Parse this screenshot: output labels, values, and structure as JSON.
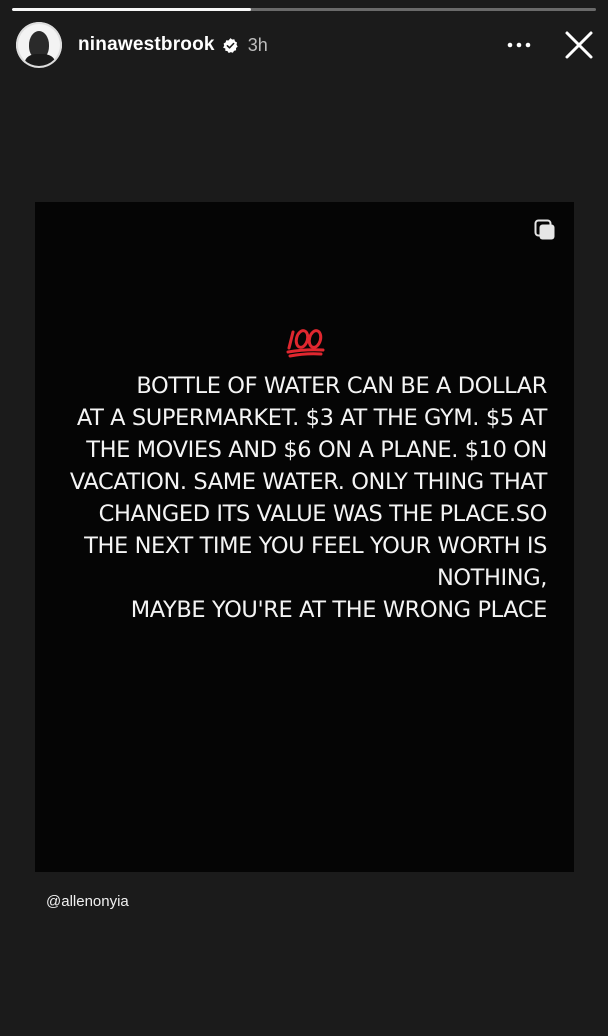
{
  "story": {
    "progress_fraction": 0.41
  },
  "header": {
    "username": "ninawestbrook",
    "time": "3h",
    "avatar": "profile-photo",
    "verified_icon": "verified-badge-icon",
    "more_icon": "more-horizontal-icon",
    "close_icon": "close-icon"
  },
  "post": {
    "emoji": "💯",
    "quote": "BOTTLE OF WATER CAN BE A DOLLAR\nAT A SUPERMARKET. $3 AT THE GYM. $5 AT\nTHE MOVIES AND $6 ON A PLANE. $10 ON\nVACATION. SAME WATER. ONLY THING THAT\nCHANGED ITS VALUE WAS THE PLACE.SO\nTHE NEXT TIME YOU FEEL YOUR WORTH IS\nNOTHING,\nMAYBE YOU'RE AT THE WRONG PLACE",
    "multi_icon": "multiple-images-icon"
  },
  "mention": "@allenonyia"
}
